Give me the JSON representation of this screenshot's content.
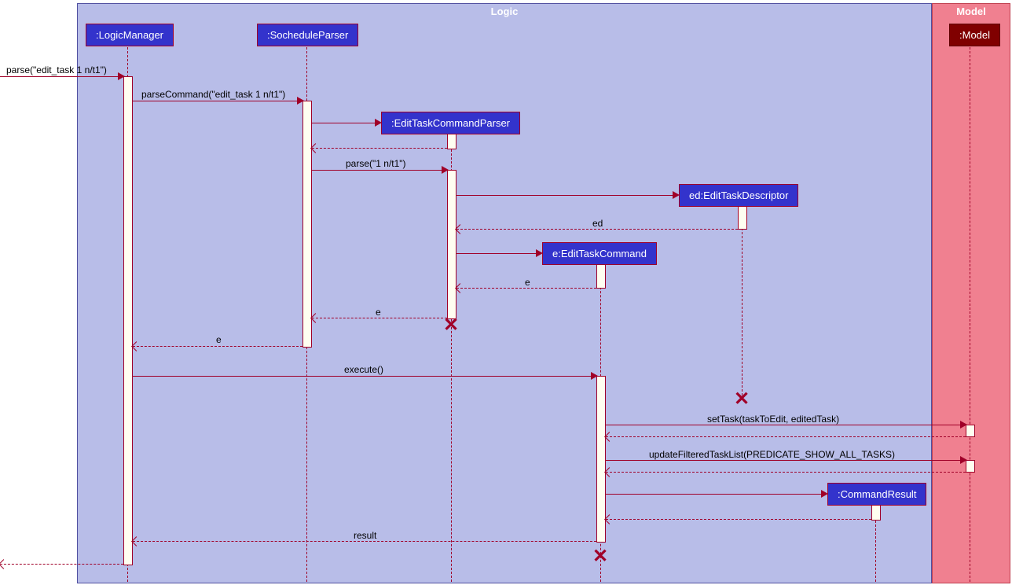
{
  "frames": {
    "logic": {
      "title": "Logic"
    },
    "model": {
      "title": "Model"
    }
  },
  "participants": {
    "logicManager": ":LogicManager",
    "socheduleParser": ":SocheduleParser",
    "editTaskCommandParser": ":EditTaskCommandParser",
    "editTaskDescriptor": "ed:EditTaskDescriptor",
    "editTaskCommand": "e:EditTaskCommand",
    "commandResult": ":CommandResult",
    "model": ":Model"
  },
  "messages": {
    "m1": "parse(\"edit_task 1 n/t1\")",
    "m2": "parseCommand(\"edit_task 1 n/t1\")",
    "m3": "parse(\"1 n/t1\")",
    "m4": "ed",
    "m5": "e",
    "m6": "e",
    "m7": "e",
    "m8": "execute()",
    "m9": "setTask(taskToEdit, editedTask)",
    "m10": "updateFilteredTaskList(PREDICATE_SHOW_ALL_TASKS)",
    "m11": "result"
  }
}
